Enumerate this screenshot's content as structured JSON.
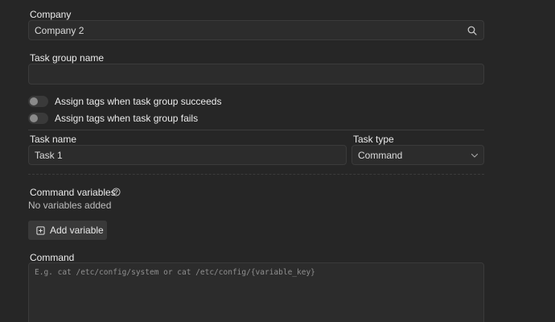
{
  "company": {
    "label": "Company",
    "value": "Company 2"
  },
  "task_group": {
    "label": "Task group name",
    "value": ""
  },
  "toggles": [
    {
      "label": "Assign tags when task group succeeds",
      "on": false
    },
    {
      "label": "Assign tags when task group fails",
      "on": false
    }
  ],
  "task": {
    "name_label": "Task name",
    "name_value": "Task 1",
    "type_label": "Task type",
    "type_value": "Command"
  },
  "variables": {
    "label": "Command variables",
    "empty_text": "No variables added",
    "add_label": "Add variable"
  },
  "command": {
    "label": "Command",
    "placeholder": "E.g. cat /etc/config/system or cat /etc/config/{variable_key}"
  },
  "icons": {
    "search": "search-icon",
    "help": "help-circle-icon",
    "chevron": "chevron-down-icon",
    "plus": "plus-square-icon"
  },
  "colors": {
    "background": "#262626",
    "input_bg": "#2c2c2c",
    "border": "#3b3b3b",
    "button_bg": "#393939"
  }
}
